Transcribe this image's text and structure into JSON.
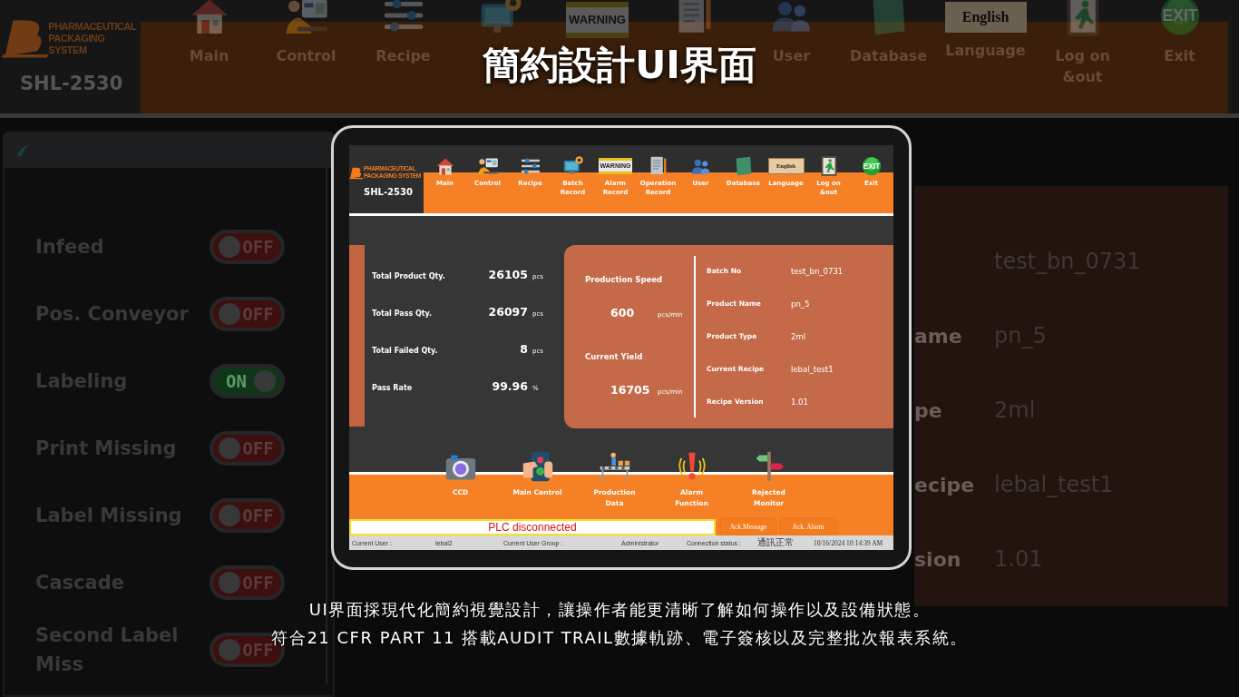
{
  "title": "簡約設計UI界面",
  "caption": [
    "UI界面採現代化簡約視覺設計，讓操作者能更清晰了解如何操作以及設備狀態。",
    "符合21 CFR PART 11 搭載AUDIT TRAIL數據軌跡、電子簽核以及完整批次報表系統。"
  ],
  "background": {
    "logo": {
      "brand": [
        "PHARMACEUTICAL",
        "PACKAGING SYSTEM"
      ],
      "model": "SHL-2530"
    },
    "nav": [
      {
        "kind": "home",
        "label": "Main"
      },
      {
        "kind": "control",
        "label": "Control"
      },
      {
        "kind": "recipe",
        "label": "Recipe"
      },
      {
        "kind": "batch"
      },
      {
        "kind": "alarm",
        "sign": "WARNING"
      },
      {
        "kind": "operation"
      },
      {
        "kind": "user",
        "label": "User"
      },
      {
        "kind": "database",
        "label": "Database"
      },
      {
        "kind": "language",
        "sign": "English",
        "label": "Language"
      },
      {
        "kind": "logon",
        "label": "Log on &out"
      },
      {
        "kind": "exit",
        "sign": "EXIT",
        "label": "Exit"
      }
    ],
    "toggles": [
      {
        "label": "Infeed",
        "state_text": "OFF",
        "on": false
      },
      {
        "label": "Pos. Conveyor",
        "state_text": "OFF",
        "on": false
      },
      {
        "label": "Labeling",
        "state_text": "ON",
        "on": true
      },
      {
        "label": "Print Missing",
        "state_text": "OFF",
        "on": false
      },
      {
        "label": "Label Missing",
        "state_text": "OFF",
        "on": false
      },
      {
        "label": "Cascade",
        "state_text": "OFF",
        "on": false
      },
      {
        "label": "Second Label Miss",
        "state_text": "OFF",
        "on": false
      }
    ],
    "info": [
      {
        "value": "test_bn_0731"
      },
      {
        "label": "ame",
        "value": "pn_5"
      },
      {
        "label": "pe",
        "value": "2ml"
      },
      {
        "label": "ecipe",
        "value": "lebal_test1"
      },
      {
        "label": "sion",
        "value": "1.01"
      }
    ]
  },
  "screen": {
    "logo": {
      "brand": [
        "PHARMACEUTICAL",
        "PACKAGING SYSTEM"
      ],
      "model": "SHL-2530"
    },
    "nav": [
      {
        "kind": "home",
        "label": "Main"
      },
      {
        "kind": "control",
        "label": "Control"
      },
      {
        "kind": "recipe",
        "label": "Recipe"
      },
      {
        "kind": "batch",
        "label": "Batch Record"
      },
      {
        "kind": "alarm",
        "sign": "WARNING",
        "label": "Alarm Record"
      },
      {
        "kind": "operation",
        "label": "Operation Record"
      },
      {
        "kind": "user",
        "label": "User"
      },
      {
        "kind": "database",
        "label": "Database"
      },
      {
        "kind": "language",
        "sign": "English",
        "label": "Language"
      },
      {
        "kind": "logon",
        "label": "Log on &out"
      },
      {
        "kind": "exit",
        "sign": "EXIT",
        "label": "Exit"
      }
    ],
    "stats": [
      {
        "label": "Total Product Qty.",
        "value": "26105",
        "unit": "pcs"
      },
      {
        "label": "Total Pass Qty.",
        "value": "26097",
        "unit": "pcs"
      },
      {
        "label": "Total Failed Qty.",
        "value": "8",
        "unit": "pcs"
      },
      {
        "label": "Pass Rate",
        "value": "99.96",
        "unit": "%"
      }
    ],
    "rates": [
      {
        "label": "Production Speed",
        "value": "600",
        "unit": "pcs/min"
      },
      {
        "label": "Current Yield",
        "value": "16705",
        "unit": "pcs/min"
      }
    ],
    "details": [
      {
        "label": "Batch No",
        "value": "test_bn_0731"
      },
      {
        "label": "Product Name",
        "value": "pn_5"
      },
      {
        "label": "Product Type",
        "value": "2ml"
      },
      {
        "label": "Current  Recipe",
        "value": "lebal_test1"
      },
      {
        "label": "Recipe Version",
        "value": "1.01"
      }
    ],
    "functions": [
      {
        "kind": "camera",
        "label": "CCD"
      },
      {
        "kind": "signal",
        "label": "Main Control"
      },
      {
        "kind": "conveyor",
        "label": "Production Data"
      },
      {
        "kind": "alarm",
        "label": "Alarm Function"
      },
      {
        "kind": "signpost",
        "label": "Rejected Monitor"
      }
    ],
    "message": "PLC disconnected",
    "buttons": [
      "Ack.Message",
      "Ack. Alarm"
    ],
    "status_bar": {
      "items": [
        {
          "label": "Current User :",
          "value": "lebal2"
        },
        {
          "label": "Current User Group :",
          "value": "Administrator"
        },
        {
          "label": "Connection status :",
          "value": "通訊正常"
        }
      ],
      "datetime": "10/16/2024 10:14:39 AM"
    }
  }
}
